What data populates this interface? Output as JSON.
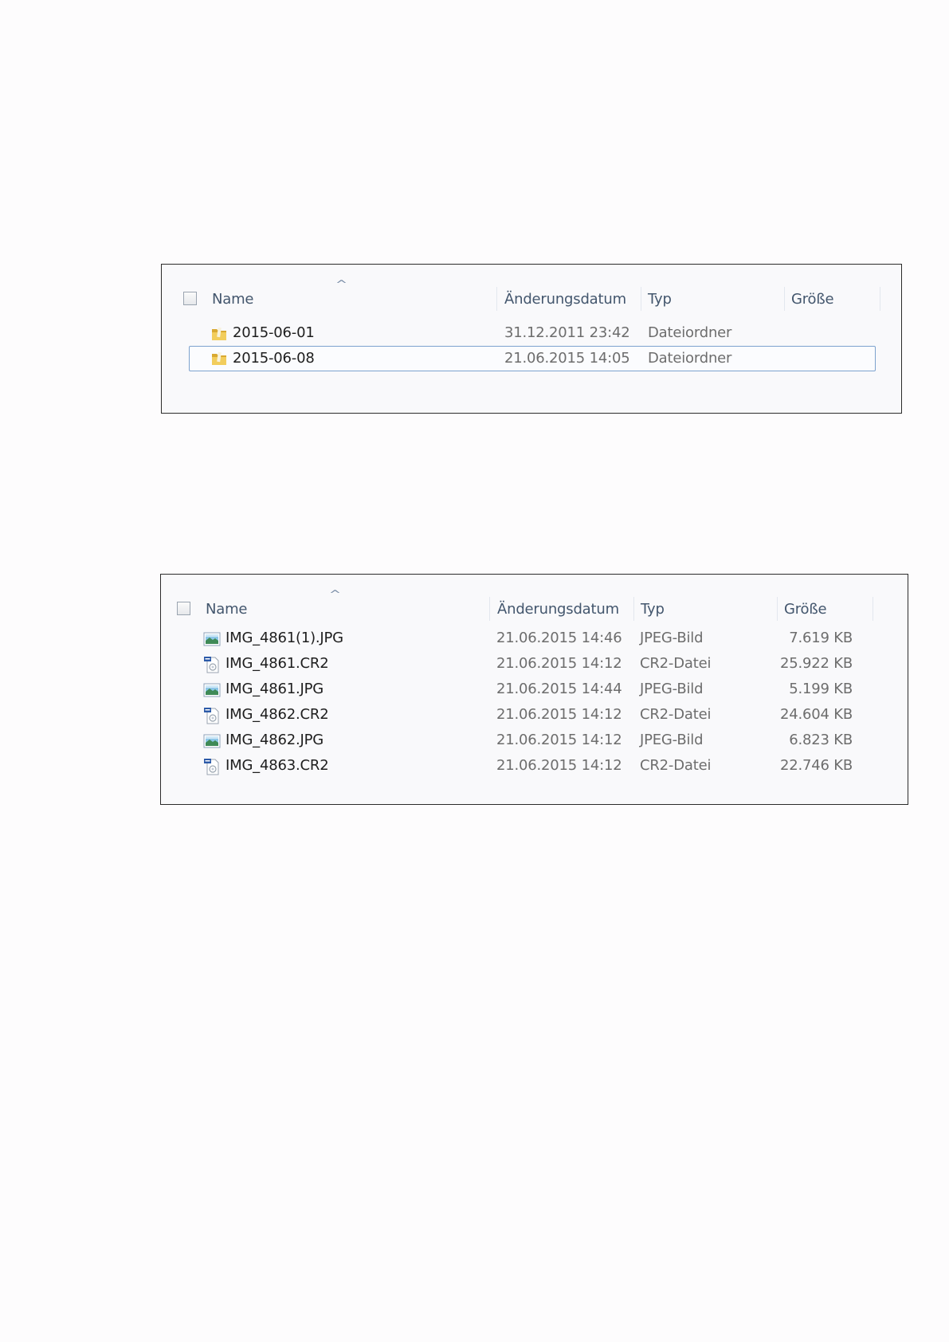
{
  "columns": {
    "name": "Name",
    "date": "Änderungsdatum",
    "type": "Typ",
    "size": "Größe",
    "sort_indicator": "^"
  },
  "folder_view": {
    "rows": [
      {
        "name": "2015-06-01",
        "date": "31.12.2011 23:42",
        "type": "Dateiordner",
        "size": "",
        "icon": "folder-icon",
        "selected": false
      },
      {
        "name": "2015-06-08",
        "date": "21.06.2015 14:05",
        "type": "Dateiordner",
        "size": "",
        "icon": "folder-icon",
        "selected": true
      }
    ]
  },
  "file_view": {
    "rows": [
      {
        "name": "IMG_4861(1).JPG",
        "date": "21.06.2015 14:46",
        "type": "JPEG-Bild",
        "size": "7.619 KB",
        "icon": "jpeg-image-icon"
      },
      {
        "name": "IMG_4861.CR2",
        "date": "21.06.2015 14:12",
        "type": "CR2-Datei",
        "size": "25.922 KB",
        "icon": "cr2-file-icon"
      },
      {
        "name": "IMG_4861.JPG",
        "date": "21.06.2015 14:44",
        "type": "JPEG-Bild",
        "size": "5.199 KB",
        "icon": "jpeg-image-icon"
      },
      {
        "name": "IMG_4862.CR2",
        "date": "21.06.2015 14:12",
        "type": "CR2-Datei",
        "size": "24.604 KB",
        "icon": "cr2-file-icon"
      },
      {
        "name": "IMG_4862.JPG",
        "date": "21.06.2015 14:12",
        "type": "JPEG-Bild",
        "size": "6.823 KB",
        "icon": "jpeg-image-icon"
      },
      {
        "name": "IMG_4863.CR2",
        "date": "21.06.2015 14:12",
        "type": "CR2-Datei",
        "size": "22.746 KB",
        "icon": "cr2-file-icon"
      }
    ]
  },
  "colors": {
    "header_text": "#43566d",
    "name_text": "#1e1e1e",
    "meta_text": "#6d6d6d",
    "selection_border": "#7da2ce",
    "frame_border": "#2b2b2b"
  }
}
